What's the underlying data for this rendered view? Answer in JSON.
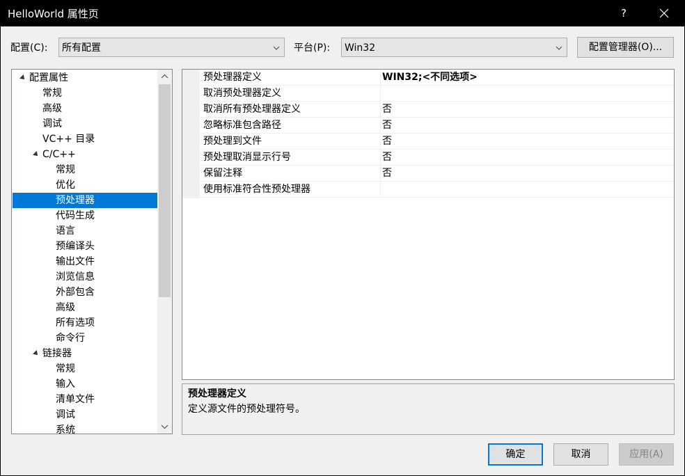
{
  "window": {
    "title": "HelloWorld 属性页",
    "help_label": "?"
  },
  "config_bar": {
    "config_label": "配置(C):",
    "config_value": "所有配置",
    "platform_label": "平台(P):",
    "platform_value": "Win32",
    "manager_button": "配置管理器(O)..."
  },
  "tree": {
    "items": [
      {
        "label": "配置属性",
        "level": 0,
        "expanded": true
      },
      {
        "label": "常规",
        "level": 1
      },
      {
        "label": "高级",
        "level": 1
      },
      {
        "label": "调试",
        "level": 1
      },
      {
        "label": "VC++ 目录",
        "level": 1
      },
      {
        "label": "C/C++",
        "level": 1,
        "expanded": true
      },
      {
        "label": "常规",
        "level": 2
      },
      {
        "label": "优化",
        "level": 2
      },
      {
        "label": "预处理器",
        "level": 2,
        "selected": true
      },
      {
        "label": "代码生成",
        "level": 2
      },
      {
        "label": "语言",
        "level": 2
      },
      {
        "label": "预编译头",
        "level": 2
      },
      {
        "label": "输出文件",
        "level": 2
      },
      {
        "label": "浏览信息",
        "level": 2
      },
      {
        "label": "外部包含",
        "level": 2
      },
      {
        "label": "高级",
        "level": 2
      },
      {
        "label": "所有选项",
        "level": 2
      },
      {
        "label": "命令行",
        "level": 2
      },
      {
        "label": "链接器",
        "level": 1,
        "expanded": true
      },
      {
        "label": "常规",
        "level": 2
      },
      {
        "label": "输入",
        "level": 2
      },
      {
        "label": "清单文件",
        "level": 2
      },
      {
        "label": "调试",
        "level": 2
      },
      {
        "label": "系统",
        "level": 2
      }
    ]
  },
  "properties": {
    "rows": [
      {
        "name": "预处理器定义",
        "value": "WIN32;<不同选项>"
      },
      {
        "name": "取消预处理器定义",
        "value": ""
      },
      {
        "name": "取消所有预处理器定义",
        "value": "否"
      },
      {
        "name": "忽略标准包含路径",
        "value": "否"
      },
      {
        "name": "预处理到文件",
        "value": "否"
      },
      {
        "name": "预处理取消显示行号",
        "value": "否"
      },
      {
        "name": "保留注释",
        "value": "否"
      },
      {
        "name": "使用标准符合性预处理器",
        "value": ""
      }
    ]
  },
  "description": {
    "title": "预处理器定义",
    "text": "定义源文件的预处理符号。"
  },
  "buttons": {
    "ok": "确定",
    "cancel": "取消",
    "apply": "应用(A)"
  },
  "colors": {
    "selection": "#0078d7",
    "titlebar": "#000000",
    "dialog_bg": "#f0f0f0"
  }
}
